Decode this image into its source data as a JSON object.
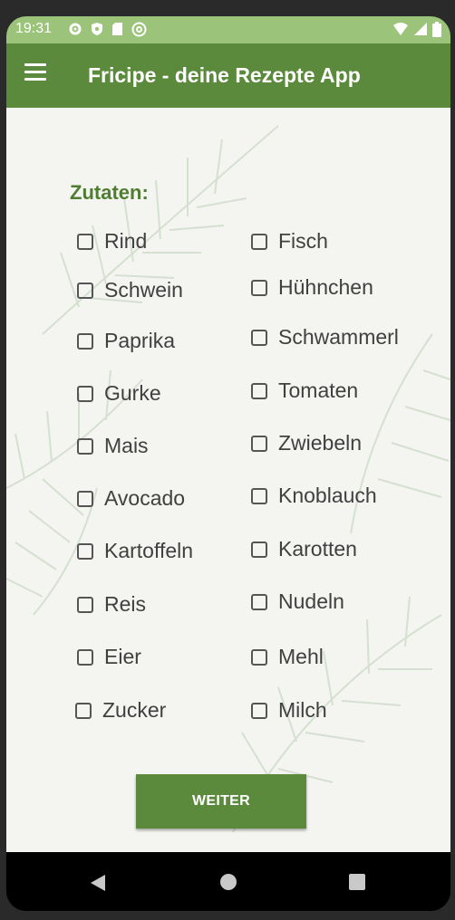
{
  "status_bar": {
    "time": "19:31",
    "left_icons": [
      "gear-icon",
      "shield-icon",
      "sd-card-icon",
      "at-sign-icon"
    ],
    "right_icons": [
      "wifi-icon",
      "signal-icon",
      "battery-icon"
    ]
  },
  "app_bar": {
    "title": "Fricipe - deine Rezepte App",
    "menu_icon": "hamburger-menu-icon"
  },
  "ingredients": {
    "heading": "Zutaten:",
    "left_column": [
      "Rind",
      "Schwein",
      "Paprika",
      "Gurke",
      "Mais",
      "Avocado",
      "Kartoffeln",
      "Reis",
      "Eier",
      "Zucker"
    ],
    "right_column": [
      "Fisch",
      "Hühnchen",
      "Schwammerl",
      "Tomaten",
      "Zwiebeln",
      "Knoblauch",
      "Karotten",
      "Nudeln",
      "Mehl",
      "Milch"
    ],
    "checked": []
  },
  "continue_button": {
    "label": "WEITER"
  },
  "nav_bar": {
    "icons": [
      "back-icon",
      "home-icon",
      "recents-icon"
    ]
  },
  "colors": {
    "status_bar": "#9bc47a",
    "app_bar": "#5b8a3c",
    "accent_text": "#4f7d31",
    "background": "#f4f4f1"
  }
}
